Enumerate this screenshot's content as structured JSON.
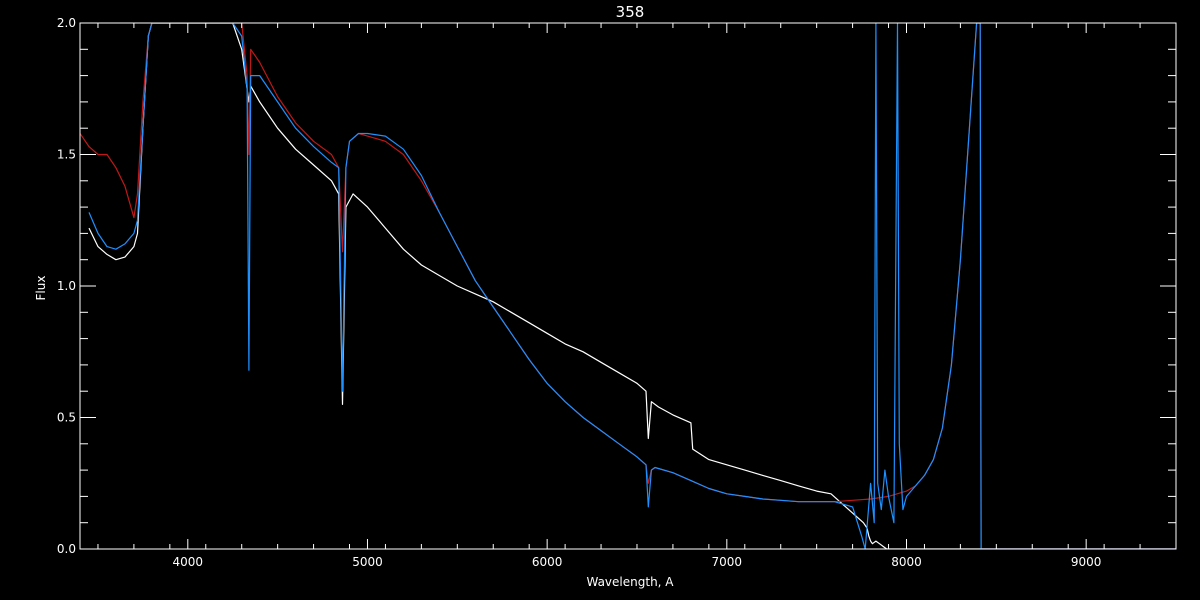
{
  "chart_data": {
    "type": "line",
    "title": "358",
    "xlabel": "Wavelength, A",
    "ylabel": "Flux",
    "xlim": [
      3400,
      9500
    ],
    "ylim": [
      0.0,
      2.0
    ],
    "x_ticks": [
      4000,
      5000,
      6000,
      7000,
      8000,
      9000
    ],
    "x_tick_labels": [
      "4000",
      "5000",
      "6000",
      "7000",
      "8000",
      "9000"
    ],
    "y_ticks": [
      0.0,
      0.5,
      1.0,
      1.5,
      2.0
    ],
    "y_tick_labels": [
      "0.0",
      "0.5",
      "1.0",
      "1.5",
      "2.0"
    ],
    "grid": false,
    "background": "#000000",
    "axis_color": "#ffffff",
    "series": [
      {
        "color": "#ffffff",
        "x": [
          3450,
          3500,
          3550,
          3600,
          3650,
          3700,
          3720,
          3750,
          3780,
          3800,
          3850,
          3900,
          3950,
          4000,
          4100,
          4200,
          4250,
          4300,
          4330,
          4340,
          4350,
          4400,
          4500,
          4600,
          4700,
          4800,
          4840,
          4861,
          4880,
          4920,
          5000,
          5100,
          5200,
          5300,
          5400,
          5500,
          5600,
          5700,
          5800,
          5900,
          6000,
          6100,
          6200,
          6300,
          6400,
          6500,
          6550,
          6563,
          6580,
          6620,
          6700,
          6800,
          6810,
          6900,
          7000,
          7100,
          7200,
          7300,
          7400,
          7500,
          7580,
          7760,
          7780,
          7790,
          7800,
          7810,
          7830,
          7850,
          7870,
          7890,
          7900,
          7950,
          8000,
          8100,
          8200,
          8300,
          8400,
          8500,
          8600,
          8700,
          8800,
          8900,
          9000,
          9100,
          9200,
          9300,
          9400,
          9500
        ],
        "y": [
          1.22,
          1.15,
          1.12,
          1.1,
          1.11,
          1.15,
          1.2,
          1.6,
          1.95,
          2.0,
          2.0,
          2.0,
          2.0,
          2.0,
          2.0,
          2.0,
          2.0,
          1.9,
          1.75,
          1.7,
          1.76,
          1.7,
          1.6,
          1.52,
          1.46,
          1.4,
          1.35,
          0.55,
          1.3,
          1.35,
          1.3,
          1.22,
          1.14,
          1.08,
          1.04,
          1.0,
          0.97,
          0.94,
          0.9,
          0.86,
          0.82,
          0.78,
          0.75,
          0.71,
          0.67,
          0.63,
          0.6,
          0.42,
          0.56,
          0.54,
          0.51,
          0.48,
          0.38,
          0.34,
          0.32,
          0.3,
          0.28,
          0.26,
          0.24,
          0.22,
          0.21,
          0.1,
          0.08,
          0.05,
          0.03,
          0.02,
          0.03,
          0.02,
          0.01,
          0.0,
          0.0,
          0.0,
          0.0,
          0.0,
          0.0,
          0.0,
          0.0,
          0.0,
          0.0,
          0.0,
          0.0,
          0.0,
          0.0,
          0.0,
          0.0,
          0.0,
          0.0,
          0.0
        ]
      },
      {
        "color": "#c01818",
        "x": [
          3400,
          3450,
          3500,
          3550,
          3600,
          3650,
          3700,
          3720,
          3750,
          3780,
          3800,
          3850,
          3900,
          3950,
          4000,
          4100,
          4200,
          4300,
          4330,
          4340,
          4350,
          4400,
          4500,
          4600,
          4700,
          4800,
          4840,
          4861,
          4880,
          4900,
          4950,
          5000,
          5100,
          5200,
          5300,
          5400,
          5500,
          5600,
          5700,
          5800,
          5900,
          6000,
          6100,
          6200,
          6300,
          6400,
          6500,
          6550,
          6563,
          6580,
          6600,
          6700,
          6800,
          6900,
          7000,
          7100,
          7200,
          7300,
          7400,
          7500,
          7600,
          7700,
          7800,
          7900,
          8000,
          8050,
          8100,
          8150,
          8200,
          8250,
          8300,
          8350,
          8390,
          8410,
          8415,
          8420,
          8425,
          8440,
          9000,
          9500
        ],
        "y": [
          1.58,
          1.53,
          1.5,
          1.5,
          1.45,
          1.38,
          1.26,
          1.35,
          1.7,
          1.95,
          2.0,
          2.0,
          2.0,
          2.0,
          2.0,
          2.0,
          2.0,
          2.0,
          1.8,
          1.5,
          1.9,
          1.85,
          1.72,
          1.62,
          1.55,
          1.5,
          1.45,
          1.13,
          1.45,
          1.55,
          1.58,
          1.57,
          1.55,
          1.5,
          1.4,
          1.28,
          1.15,
          1.02,
          0.92,
          0.82,
          0.72,
          0.63,
          0.56,
          0.5,
          0.45,
          0.4,
          0.35,
          0.32,
          0.25,
          0.3,
          0.31,
          0.29,
          0.26,
          0.23,
          0.21,
          0.2,
          0.19,
          0.185,
          0.18,
          0.18,
          0.18,
          0.185,
          0.19,
          0.2,
          0.22,
          0.24,
          0.28,
          0.34,
          0.46,
          0.7,
          1.1,
          1.6,
          2.0,
          2.0,
          0.0,
          0.0,
          0.0,
          0.0,
          0.0,
          0.0
        ]
      },
      {
        "color": "#1e90ff",
        "x": [
          3450,
          3500,
          3550,
          3600,
          3650,
          3700,
          3720,
          3750,
          3780,
          3800,
          3850,
          3900,
          3950,
          4000,
          4100,
          4200,
          4250,
          4300,
          4330,
          4340,
          4350,
          4400,
          4500,
          4600,
          4700,
          4800,
          4840,
          4861,
          4880,
          4900,
          4950,
          5000,
          5100,
          5200,
          5300,
          5400,
          5500,
          5600,
          5700,
          5800,
          5900,
          6000,
          6100,
          6200,
          6300,
          6400,
          6500,
          6550,
          6563,
          6580,
          6600,
          6700,
          6800,
          6900,
          7000,
          7100,
          7200,
          7300,
          7400,
          7500,
          7600,
          7700,
          7750,
          7770,
          7800,
          7820,
          7830,
          7840,
          7860,
          7880,
          7900,
          7930,
          7950,
          7960,
          7980,
          8000,
          8050,
          8100,
          8150,
          8200,
          8250,
          8300,
          8350,
          8390,
          8410,
          8415,
          8420,
          8425,
          8440,
          9000,
          9500
        ],
        "y": [
          1.28,
          1.2,
          1.15,
          1.14,
          1.16,
          1.2,
          1.25,
          1.6,
          1.95,
          2.0,
          2.0,
          2.0,
          2.0,
          2.0,
          2.0,
          2.0,
          2.0,
          1.95,
          1.75,
          0.68,
          1.8,
          1.8,
          1.7,
          1.6,
          1.53,
          1.47,
          1.45,
          0.6,
          1.45,
          1.55,
          1.58,
          1.58,
          1.57,
          1.52,
          1.42,
          1.28,
          1.15,
          1.02,
          0.92,
          0.82,
          0.72,
          0.63,
          0.56,
          0.5,
          0.45,
          0.4,
          0.35,
          0.32,
          0.16,
          0.3,
          0.31,
          0.29,
          0.26,
          0.23,
          0.21,
          0.2,
          0.19,
          0.185,
          0.18,
          0.18,
          0.18,
          0.16,
          0.05,
          0.0,
          0.25,
          0.1,
          2.0,
          0.25,
          0.15,
          0.3,
          0.2,
          0.1,
          2.0,
          0.4,
          0.15,
          0.2,
          0.24,
          0.28,
          0.34,
          0.46,
          0.7,
          1.1,
          1.6,
          2.0,
          2.0,
          0.0,
          0.0,
          0.0,
          0.0,
          0.0,
          0.0
        ]
      }
    ]
  }
}
